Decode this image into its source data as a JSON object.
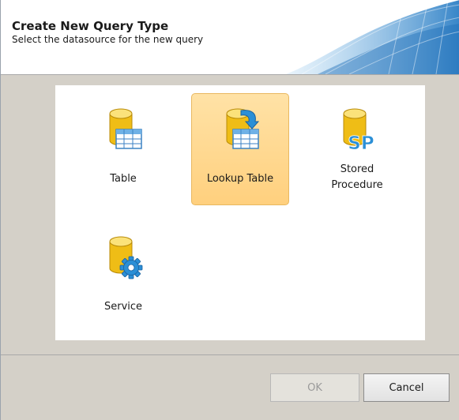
{
  "header": {
    "title": "Create New Query Type",
    "subtitle": "Select the datasource for the new query"
  },
  "tiles": [
    {
      "label_lines": [
        "Table"
      ],
      "icon": "database-table-icon",
      "selected": false
    },
    {
      "label_lines": [
        "Lookup Table"
      ],
      "icon": "database-lookup-table-icon",
      "selected": true
    },
    {
      "label_lines": [
        "Stored",
        "Procedure"
      ],
      "icon": "stored-procedure-icon",
      "selected": false
    },
    {
      "label_lines": [
        "Service"
      ],
      "icon": "database-service-gear-icon",
      "selected": false
    }
  ],
  "buttons": {
    "ok_label": "OK",
    "ok_enabled": false,
    "cancel_label": "Cancel"
  },
  "colors": {
    "selection": "#ffd07e",
    "database_yellow": "#f2c21a",
    "accent_blue": "#2b8fd6"
  }
}
